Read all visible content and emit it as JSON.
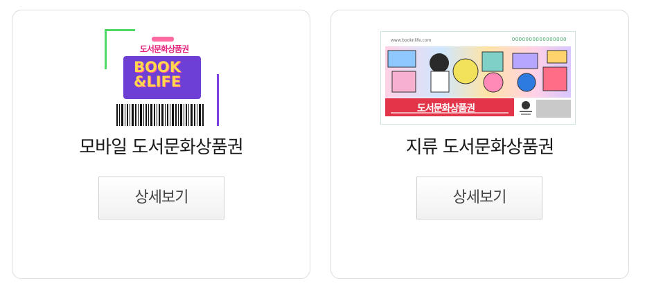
{
  "cards": [
    {
      "title": "모바일 도서문화상품권",
      "button_label": "상세보기",
      "image": {
        "brand": "도서문화상품권",
        "panel_line1": "BOOK",
        "panel_line2": "&LIFE"
      }
    },
    {
      "title": "지류 도서문화상품권",
      "button_label": "상세보기",
      "image": {
        "url": "www.booknlife.com",
        "serial": "0000000000000000",
        "brand": "도서문화상품권"
      }
    }
  ],
  "colors": {
    "brand_pink": "#e4257e",
    "panel_purple": "#6e3fd4",
    "accent_green": "#4cd964",
    "paper_red": "#e2354a"
  }
}
